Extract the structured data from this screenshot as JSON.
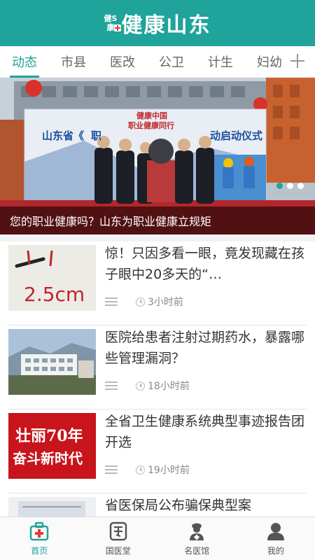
{
  "header": {
    "logo_small_top": "健S",
    "logo_small_bottom": "康",
    "title": "健康山东",
    "color": "#1fa39a"
  },
  "tabs": [
    {
      "label": "动态",
      "active": true
    },
    {
      "label": "市县",
      "active": false
    },
    {
      "label": "医改",
      "active": false
    },
    {
      "label": "公卫",
      "active": false
    },
    {
      "label": "计生",
      "active": false
    },
    {
      "label": "妇幼",
      "active": false
    }
  ],
  "banner": {
    "caption": "您的职业健康吗？山东为职业健康立规矩",
    "backdrop_text_left": "山东省《",
    "backdrop_text_mid": "职",
    "backdrop_text_right": "动启动仪式",
    "backdrop_logo_line1": "健康中国",
    "backdrop_logo_line2": "职业健康同行",
    "dots_count": 3,
    "active_dot": 0
  },
  "news": [
    {
      "title": "惊！只因多看一眼，竟发现藏在孩子眼中20多天的“…",
      "time": "3小时前",
      "thumb": "pencil",
      "thumb_text": "2.5cm"
    },
    {
      "title": "医院给患者注射过期药水，暴露哪些管理漏洞？",
      "time": "18小时前",
      "thumb": "hospital",
      "thumb_text": ""
    },
    {
      "title": "全省卫生健康系统典型事迹报告团开选",
      "time": "19小时前",
      "thumb": "poster",
      "thumb_text_1": "壮丽70年",
      "thumb_text_2": "奋斗新时代"
    },
    {
      "title": "省医保局公布骗保典型案",
      "time": "",
      "thumb": "doc",
      "thumb_text": ""
    }
  ],
  "bottom_nav": [
    {
      "label": "首页",
      "icon": "medical-kit-icon",
      "active": true
    },
    {
      "label": "国医堂",
      "icon": "seal-icon",
      "active": false
    },
    {
      "label": "名医馆",
      "icon": "doctor-icon",
      "active": false
    },
    {
      "label": "我的",
      "icon": "user-icon",
      "active": false
    }
  ]
}
